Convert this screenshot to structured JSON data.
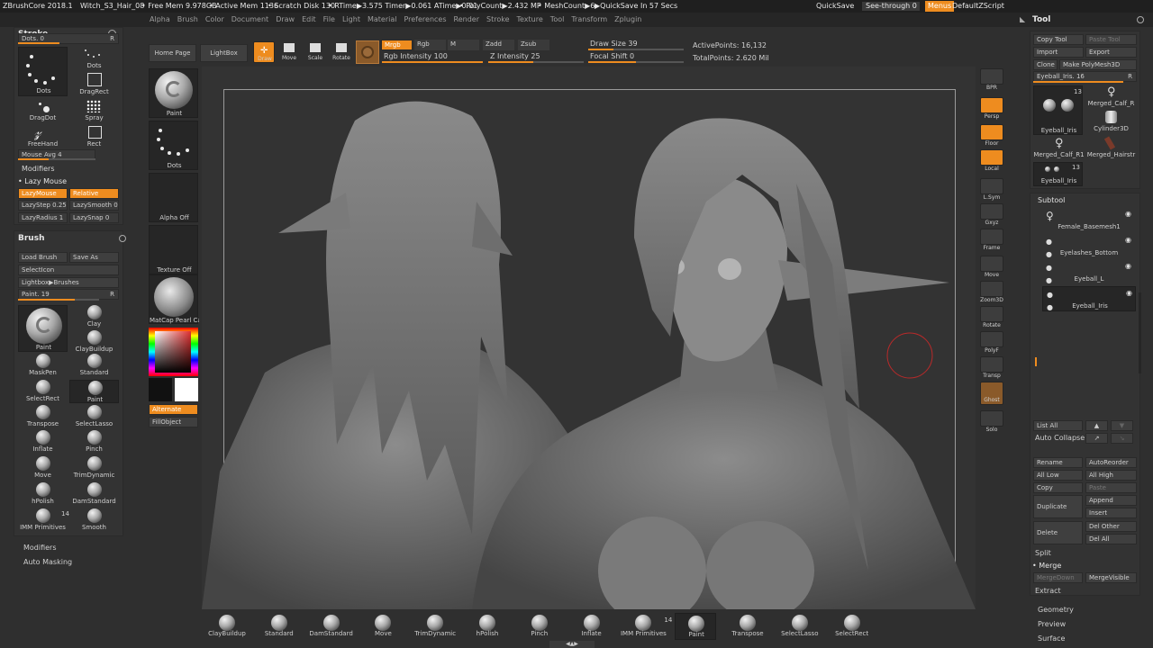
{
  "topbar": {
    "app": "ZBrushCore 2018.1",
    "file": "Witch_S3_Hair_08",
    "free_mem": "• Free Mem 9.978GB",
    "active_mem": "• Active Mem 1136",
    "scratch": "• Scratch Disk 130",
    "rtime": "• RTime▶3.575 Timer▶0.061 ATime▶0.01",
    "polycount": "• PolyCount▶2.432 MP",
    "meshcount": "• MeshCount▶6",
    "quicksave_in": "▶QuickSave In 57 Secs",
    "quicksave": "QuickSave",
    "seethrough": "See-through  0",
    "menus": "Menus",
    "script": "DefaultZScript"
  },
  "menus": [
    "Alpha",
    "Brush",
    "Color",
    "Document",
    "Draw",
    "Edit",
    "File",
    "Light",
    "Material",
    "Preferences",
    "Render",
    "Stroke",
    "Texture",
    "Tool",
    "Transform",
    "Zplugin"
  ],
  "stroke": {
    "title": "Stroke",
    "dots_slider": "Dots. 0",
    "r": "R",
    "dots_big": "Dots",
    "dots_small": "Dots",
    "dragrect": "DragRect",
    "dragdot": "DragDot",
    "spray": "Spray",
    "freehand": "FreeHand",
    "rect": "Rect",
    "mouse_avg": "Mouse Avg 4",
    "modifiers": "Modifiers",
    "lazy_mouse": "Lazy Mouse",
    "lazymouse_btn": "LazyMouse",
    "relative": "Relative",
    "lazystep": "LazyStep 0.25",
    "lazysmooth": "LazySmooth 0",
    "lazyradius": "LazyRadius 1",
    "lazysnap": "LazySnap 0"
  },
  "brush": {
    "title": "Brush",
    "load": "Load Brush",
    "saveas": "Save As",
    "selecticon": "SelectIcon",
    "lightbox": "Lightbox▶Brushes",
    "paint_slider": "Paint. 19",
    "r": "R",
    "items": [
      "Paint",
      "Clay",
      "ClayBuildup",
      "MaskPen",
      "Standard",
      "SelectRect",
      "Paint",
      "Transpose",
      "SelectLasso",
      "Inflate",
      "Pinch",
      "Move",
      "TrimDynamic",
      "hPolish",
      "DamStandard",
      "IMM Primitives",
      "Smooth"
    ],
    "imm_count": "14",
    "modifiers": "Modifiers",
    "automasking": "Auto Masking"
  },
  "shelf": {
    "homepage": "Home Page",
    "lightbox": "LightBox",
    "draw": "Draw",
    "move": "Move",
    "scale": "Scale",
    "rotate": "Rotate",
    "mrgb": "Mrgb",
    "rgb": "Rgb",
    "m": "M",
    "zadd": "Zadd",
    "zsub": "Zsub",
    "rgb_intensity": "Rgb Intensity 100",
    "z_intensity": "Z Intensity 25",
    "draw_size": "Draw Size 39",
    "focal_shift": "Focal Shift 0",
    "active_points": "ActivePoints: 16,132",
    "total_points": "TotalPoints: 2.620 Mil"
  },
  "tray": {
    "paint": "Paint",
    "dots": "Dots",
    "alpha": "Alpha Off",
    "texture": "Texture Off",
    "matcap": "MatCap Pearl Ca",
    "alternate": "Alternate",
    "fillobject": "FillObject"
  },
  "rightbar": [
    "BPR",
    "Persp",
    "Floor",
    "Local",
    "L.Sym",
    "Gxyz",
    "Frame",
    "Move",
    "Zoom3D",
    "Rotate",
    "PolyF",
    "Transp",
    "Ghost",
    "Solo"
  ],
  "tool": {
    "title": "Tool",
    "copy": "Copy Tool",
    "paste": "Paste Tool",
    "import": "Import",
    "export": "Export",
    "clone": "Clone",
    "polymesh": "Make PolyMesh3D",
    "slider": "Eyeball_Iris. 16",
    "r": "R",
    "thumbs": [
      "Eyeball_Iris",
      "Merged_Calf_R",
      "Cylinder3D",
      "Merged_Calf_R1",
      "Merged_Hairstr",
      "Eyeball_Iris"
    ],
    "count1": "13",
    "count2": "13"
  },
  "subtool": {
    "title": "Subtool",
    "items": [
      "Female_Basemesh1",
      "Eyelashes_Bottom",
      "Eyeball_L",
      "Eyeball_Iris"
    ],
    "listall": "List All",
    "autocollapse": "Auto Collapse",
    "rename": "Rename",
    "autoreorder": "AutoReorder",
    "alllow": "All Low",
    "allhigh": "All High",
    "copy": "Copy",
    "paste": "Paste",
    "duplicate": "Duplicate",
    "append": "Append",
    "insert": "Insert",
    "delete": "Delete",
    "delother": "Del Other",
    "delall": "Del All",
    "split": "Split",
    "merge": "Merge",
    "mergedown": "MergeDown",
    "mergevisible": "MergeVisible",
    "extract": "Extract",
    "geometry": "Geometry",
    "preview": "Preview",
    "surface": "Surface"
  },
  "bottom": [
    "ClayBuildup",
    "Standard",
    "DamStandard",
    "Move",
    "TrimDynamic",
    "hPolish",
    "Pinch",
    "Inflate",
    "IMM Primitives",
    "Paint",
    "Transpose",
    "SelectLasso",
    "SelectRect"
  ],
  "bottom_imm_count": "14"
}
